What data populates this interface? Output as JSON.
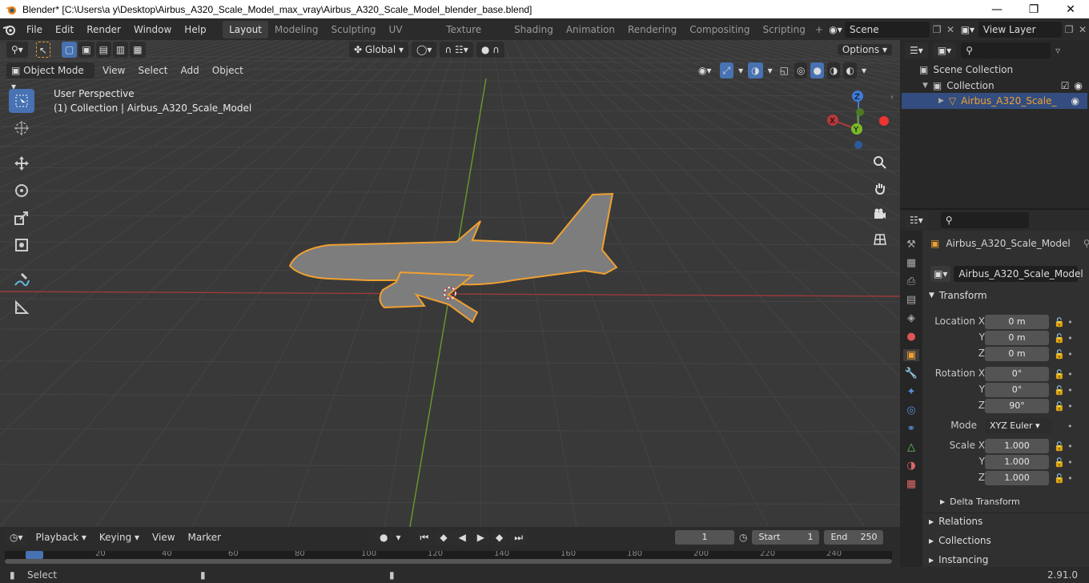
{
  "window": {
    "title": "Blender* [C:\\Users\\a y\\Desktop\\Airbus_A320_Scale_Model_max_vray\\Airbus_A320_Scale_Model_blender_base.blend]"
  },
  "menus": [
    "File",
    "Edit",
    "Render",
    "Window",
    "Help"
  ],
  "workspaces": [
    "Layout",
    "Modeling",
    "Sculpting",
    "UV Editing",
    "Texture Paint",
    "Shading",
    "Animation",
    "Rendering",
    "Compositing",
    "Scripting"
  ],
  "scene": {
    "name": "Scene",
    "view_layer": "View Layer"
  },
  "viewport": {
    "mode": "Object Mode",
    "menus": [
      "View",
      "Select",
      "Add",
      "Object"
    ],
    "orientation": "Global",
    "options": "Options",
    "perspective": "User Perspective",
    "collection_info": "(1) Collection | Airbus_A320_Scale_Model"
  },
  "outliner": {
    "scene_collection": "Scene Collection",
    "collection": "Collection",
    "object": "Airbus_A320_Scale_"
  },
  "properties": {
    "object_name": "Airbus_A320_Scale_Model",
    "data_name": "Airbus_A320_Scale_Model",
    "transform": "Transform",
    "location_label": "Location X",
    "y_label": "Y",
    "z_label": "Z",
    "location": [
      "0 m",
      "0 m",
      "0 m"
    ],
    "rotation_label": "Rotation X",
    "rotation": [
      "0°",
      "0°",
      "90°"
    ],
    "mode_label": "Mode",
    "mode": "XYZ Euler",
    "scale_label": "Scale X",
    "scale": [
      "1.000",
      "1.000",
      "1.000"
    ],
    "delta": "Delta Transform",
    "relations": "Relations",
    "collections": "Collections",
    "instancing": "Instancing"
  },
  "timeline": {
    "menus": [
      "Playback",
      "Keying",
      "View",
      "Marker"
    ],
    "current_frame": "1",
    "start_label": "Start",
    "start": "1",
    "end_label": "End",
    "end": "250",
    "ticks": [
      "1",
      "20",
      "40",
      "60",
      "80",
      "100",
      "120",
      "140",
      "160",
      "180",
      "200",
      "220",
      "240"
    ]
  },
  "status": {
    "select": "Select",
    "version": "2.91.0"
  },
  "colors": {
    "accent": "#4772b3",
    "selection": "#f0a030",
    "x_axis": "#b33a3a",
    "y_axis": "#6a9a2a"
  }
}
